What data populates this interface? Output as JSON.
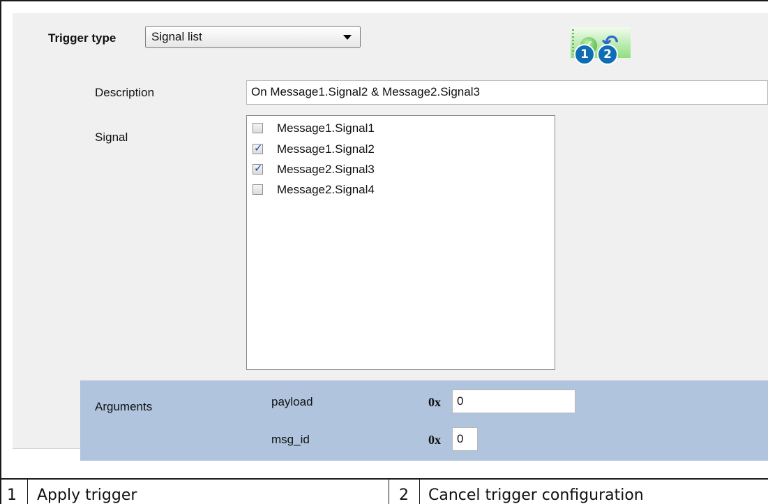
{
  "trigger_type": {
    "label": "Trigger type",
    "selected": "Signal list"
  },
  "toolbar": {
    "apply_icon": "check-icon",
    "cancel_icon": "undo-icon",
    "badge_1": "1",
    "badge_2": "2"
  },
  "description": {
    "label": "Description",
    "value": "On Message1.Signal2 & Message2.Signal3"
  },
  "signal": {
    "label": "Signal",
    "items": [
      {
        "label": "Message1.Signal1",
        "checked": false
      },
      {
        "label": "Message1.Signal2",
        "checked": true
      },
      {
        "label": "Message2.Signal3",
        "checked": true
      },
      {
        "label": "Message2.Signal4",
        "checked": false
      }
    ]
  },
  "arguments": {
    "label": "Arguments",
    "rows": [
      {
        "name": "payload",
        "prefix": "0x",
        "value": "0"
      },
      {
        "name": "msg_id",
        "prefix": "0x",
        "value": "0"
      }
    ]
  },
  "legend": [
    {
      "number": "1",
      "text": "Apply trigger"
    },
    {
      "number": "2",
      "text": "Cancel trigger configuration"
    }
  ]
}
